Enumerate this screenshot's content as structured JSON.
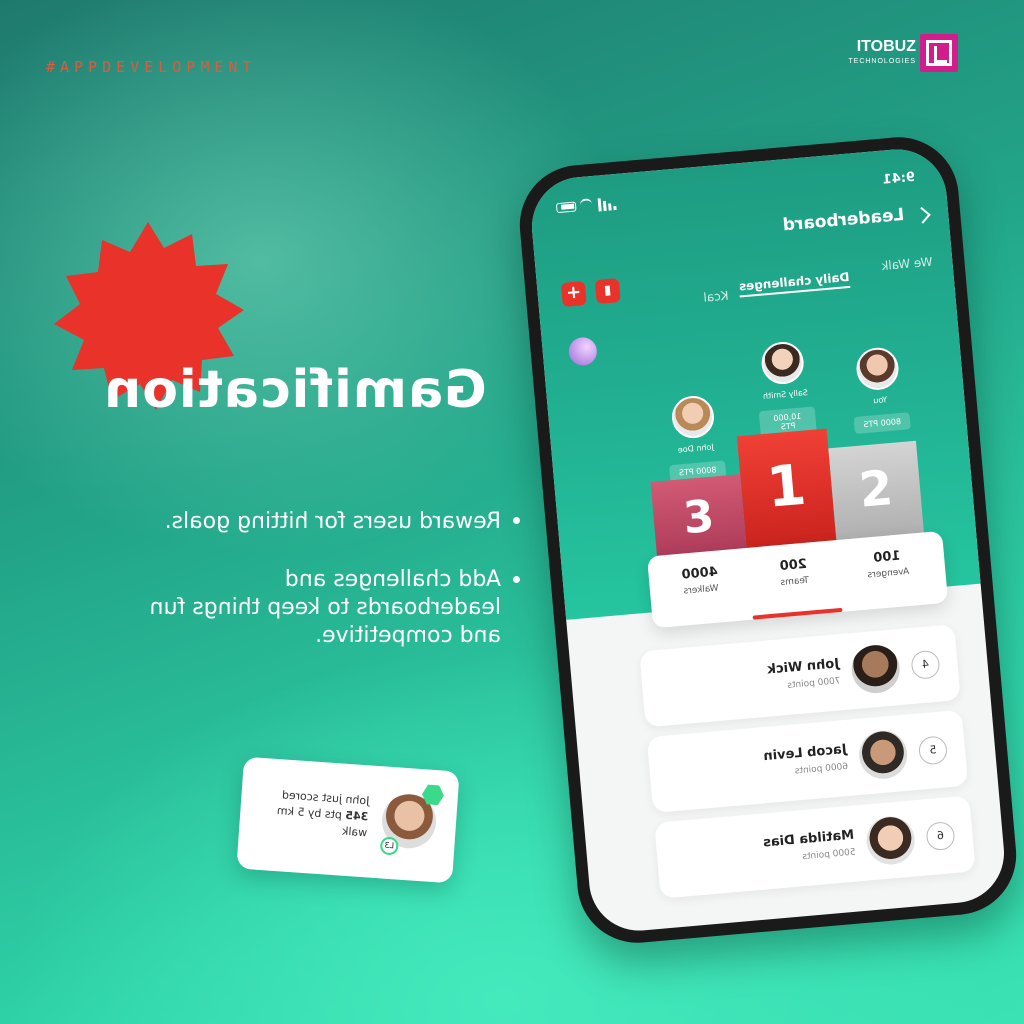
{
  "header": {
    "hashtag": "#APPDEVELOPMENT",
    "brand_name": "ITOBUZ",
    "brand_sub": "TECHNOLOGIES"
  },
  "hero": {
    "headline": "Gamification",
    "bullets": [
      "Reward users for hitting goals.",
      "Add challenges and leaderboards to keep things fun and competitive."
    ]
  },
  "notification": {
    "text_prefix": "John just scored",
    "points": "345",
    "text_suffix": "pts by 5 km walk",
    "level": "L3"
  },
  "phone": {
    "status_time": "9:41",
    "title": "Leaderboard",
    "tabs": [
      "We Walk",
      "Daily challenges",
      "Kcal"
    ],
    "active_tab": "Daily challenges",
    "podium": [
      {
        "rank": "1",
        "name": "Sally Smith",
        "points": "10,000 PTS"
      },
      {
        "rank": "2",
        "name": "You",
        "points": "8000 PTS"
      },
      {
        "rank": "3",
        "name": "John Doe",
        "points": "8000 PTS"
      }
    ],
    "stats": [
      {
        "value": "100",
        "label": "Avengers"
      },
      {
        "value": "200",
        "label": "Teams"
      },
      {
        "value": "4000",
        "label": "Walkers"
      }
    ],
    "leaderboard": [
      {
        "rank": "4",
        "name": "John Wick",
        "points": "7000 points"
      },
      {
        "rank": "5",
        "name": "Jacob Levin",
        "points": "6000 points"
      },
      {
        "rank": "6",
        "name": "Matilda Dias",
        "points": "5000 points"
      }
    ]
  },
  "colors": {
    "accent_red": "#e8322a",
    "brand_pink": "#d21e8c",
    "teal": "#22b394"
  }
}
